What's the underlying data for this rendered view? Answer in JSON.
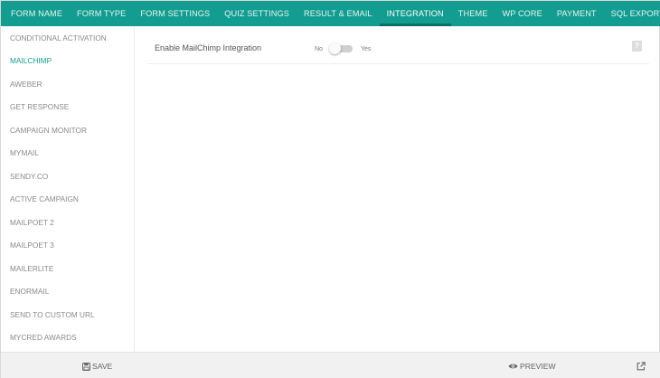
{
  "nav": {
    "tabs": [
      {
        "label": "FORM NAME"
      },
      {
        "label": "FORM TYPE"
      },
      {
        "label": "FORM SETTINGS"
      },
      {
        "label": "QUIZ SETTINGS"
      },
      {
        "label": "RESULT & EMAIL"
      },
      {
        "label": "INTEGRATION",
        "active": true
      },
      {
        "label": "THEME"
      },
      {
        "label": "WP CORE"
      },
      {
        "label": "PAYMENT"
      },
      {
        "label": "SQL EXPORT"
      }
    ]
  },
  "sidebar": {
    "items": [
      {
        "label": "CONDITIONAL ACTIVATION"
      },
      {
        "label": "MAILCHIMP",
        "active": true
      },
      {
        "label": "AWEBER"
      },
      {
        "label": "GET RESPONSE"
      },
      {
        "label": "CAMPAIGN MONITOR"
      },
      {
        "label": "MYMAIL"
      },
      {
        "label": "SENDY.CO"
      },
      {
        "label": "ACTIVE CAMPAIGN"
      },
      {
        "label": "MAILPOET 2"
      },
      {
        "label": "MAILPOET 3"
      },
      {
        "label": "MAILERLITE"
      },
      {
        "label": "ENORMAIL"
      },
      {
        "label": "SEND TO CUSTOM URL"
      },
      {
        "label": "MYCRED AWARDS"
      }
    ]
  },
  "main": {
    "setting_label": "Enable MailChimp Integration",
    "toggle_off_label": "No",
    "toggle_on_label": "Yes",
    "toggle_state": "off",
    "help_label": "?"
  },
  "footer": {
    "save_label": "SAVE",
    "preview_label": "PREVIEW"
  },
  "colors": {
    "accent": "#139d90",
    "accent_dark": "#0c6f66",
    "footer_bg": "#f1f1f1"
  },
  "icons": {
    "save": "floppy-disk-icon",
    "preview": "eye-icon",
    "external": "external-link-icon",
    "help": "question-icon"
  }
}
